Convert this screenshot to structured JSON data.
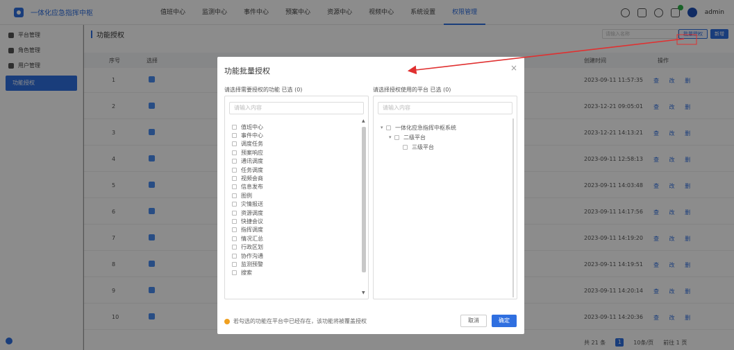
{
  "header": {
    "app_title": "一体化应急指挥中枢",
    "nav": [
      "值班中心",
      "监测中心",
      "事件中心",
      "预案中心",
      "资源中心",
      "视频中心",
      "系统设置",
      "权限管理"
    ],
    "active_nav_index": 7,
    "username": "admin"
  },
  "sidebar": {
    "items": [
      {
        "label": "平台管理",
        "icon": "platform-icon"
      },
      {
        "label": "角色管理",
        "icon": "user-icon"
      },
      {
        "label": "用户管理",
        "icon": "user-icon"
      },
      {
        "label": "功能授权",
        "icon": "none"
      }
    ],
    "active_index": 3
  },
  "page": {
    "title": "功能授权",
    "search_placeholder": "请输入名称",
    "batch_button": "批量授权",
    "add_button": "新增",
    "columns": {
      "index": "序号",
      "select": "选择",
      "time": "创建时间",
      "ops": "操作"
    },
    "rows": [
      {
        "index": "1",
        "time": "2023-09-11 11:57:35"
      },
      {
        "index": "2",
        "time": "2023-12-21 09:05:01"
      },
      {
        "index": "3",
        "time": "2023-12-21 14:13:21"
      },
      {
        "index": "4",
        "time": "2023-09-11 12:58:13"
      },
      {
        "index": "5",
        "time": "2023-09-11 14:03:48"
      },
      {
        "index": "6",
        "time": "2023-09-11 14:17:56"
      },
      {
        "index": "7",
        "time": "2023-09-11 14:19:20"
      },
      {
        "index": "8",
        "time": "2023-09-11 14:19:51"
      },
      {
        "index": "9",
        "time": "2023-09-11 14:20:14"
      },
      {
        "index": "10",
        "time": "2023-09-11 14:20:36"
      }
    ],
    "ops_label": "查 改 删",
    "pagination": {
      "total": "共 21 条",
      "current": "1",
      "page_size": "10条/页",
      "goto": "前往 1 页"
    }
  },
  "dialog": {
    "title": "功能批量授权",
    "left_label": "请选择需要授权的功能 已选 (0)",
    "right_label": "请选择授权使用的平台 已选 (0)",
    "left_search_placeholder": "请输入内容",
    "right_search_placeholder": "请输入内容",
    "functions": [
      "值班中心",
      "事件中心",
      "调度任务",
      "预案响应",
      "通讯调度",
      "任务调度",
      "视频会商",
      "信息发布",
      "图例",
      "灾情报送",
      "资源调度",
      "快捷会议",
      "指挥调度",
      "情况汇总",
      "行政区划",
      "协作沟通",
      "监测预警",
      "搜索"
    ],
    "platform_tree": {
      "root": "一体化应急指挥中枢系统",
      "children": [
        {
          "label": "二级平台",
          "children": [
            {
              "label": "三级平台"
            }
          ]
        }
      ]
    },
    "footer_note": "若勾选的功能在平台中已经存在，该功能将被覆盖授权",
    "cancel_button": "取消",
    "confirm_button": "确定"
  },
  "colors": {
    "accent": "#2f6fe0",
    "annotation_arrow": "#e03030"
  }
}
